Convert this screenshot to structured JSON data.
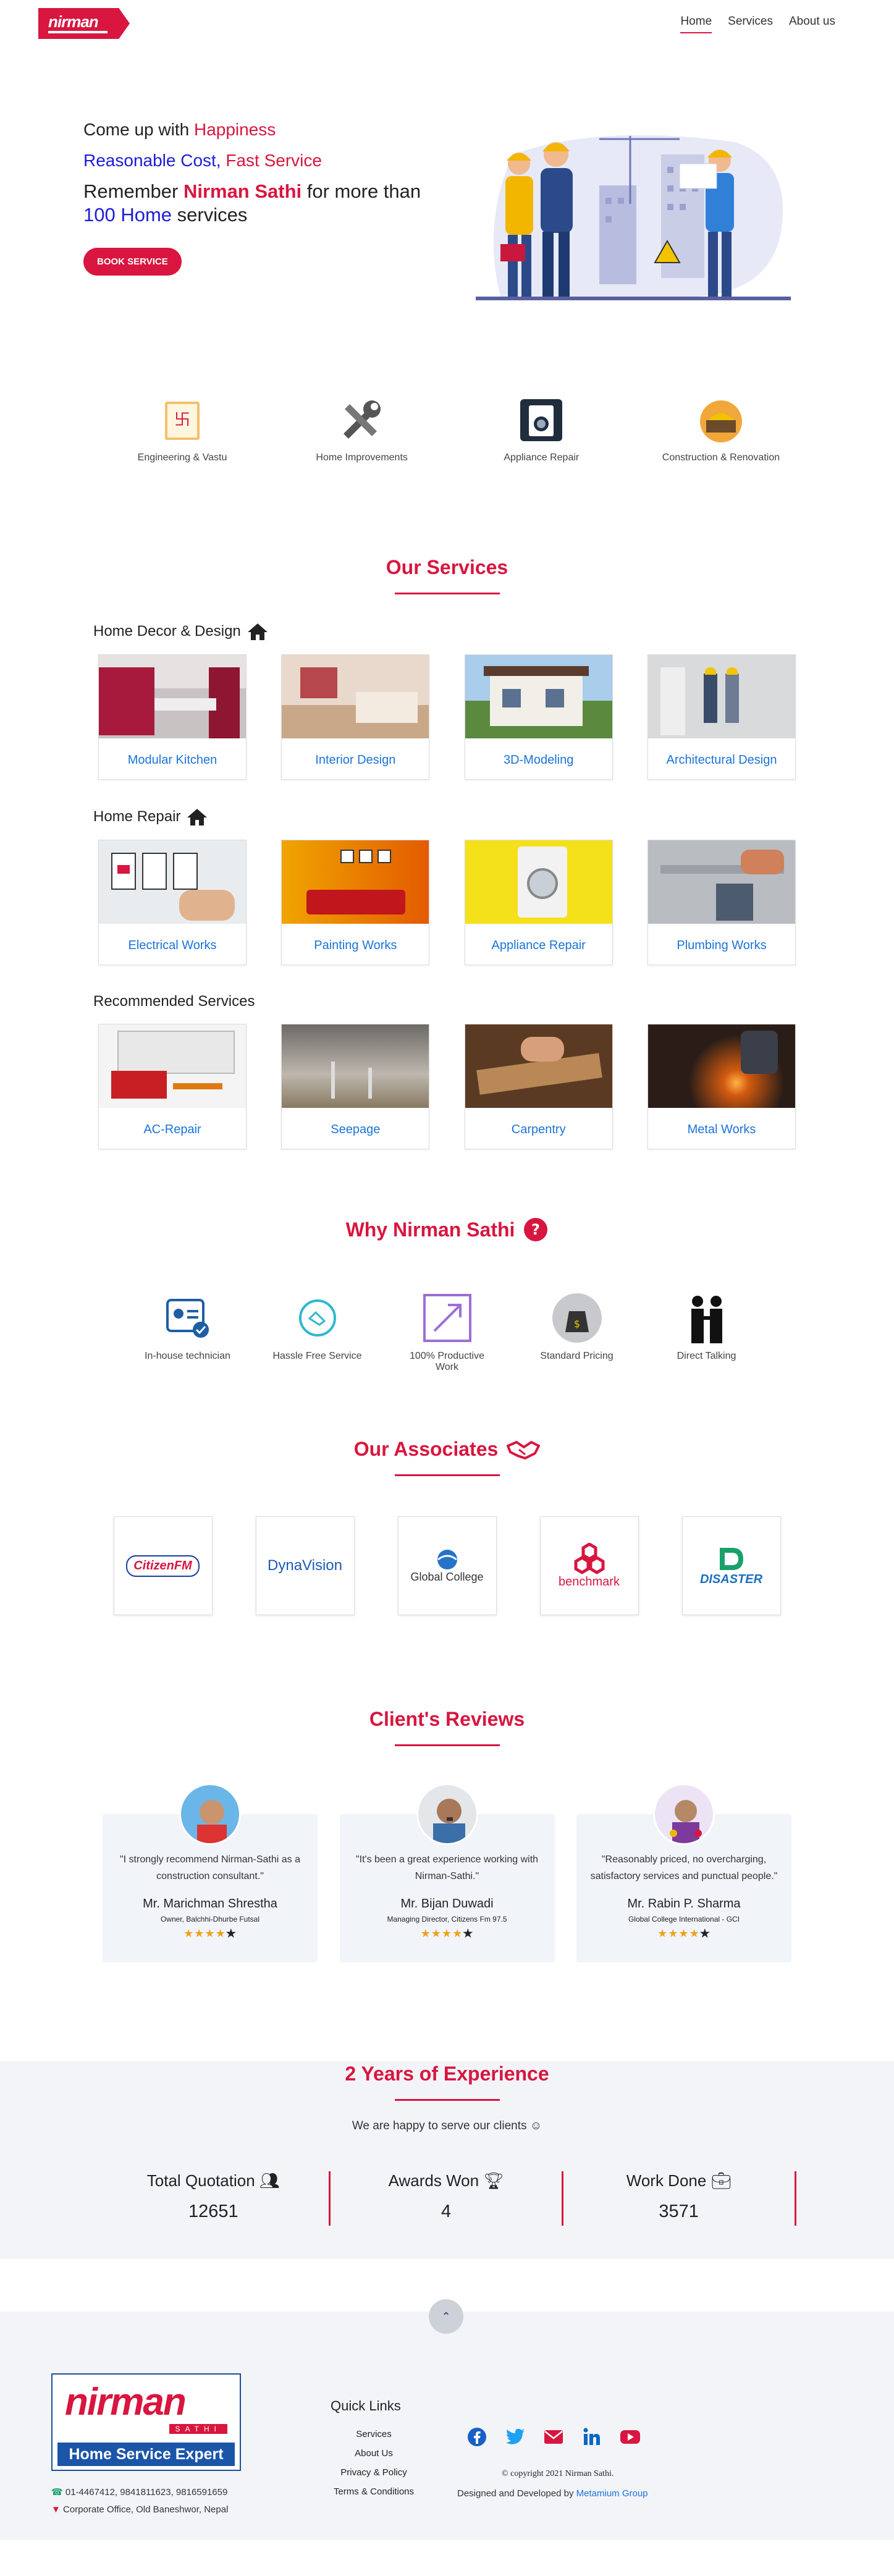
{
  "nav": {
    "logo": "nirman",
    "links": [
      "Home",
      "Services",
      "About us"
    ]
  },
  "hero": {
    "line1_a": "Come up with ",
    "line1_b": "Happiness",
    "line2_a": "Reasonable Cost, ",
    "line2_b": "Fast Service",
    "line3_a": "Remember ",
    "line3_b": "Nirman Sathi",
    "line3_c": " for more than",
    "line4_a": "100 Home",
    "line4_b": " services",
    "button": "BOOK SERVICE"
  },
  "categories": [
    "Engineering & Vastu",
    "Home Improvements",
    "Appliance Repair",
    "Construction & Renovation"
  ],
  "services": {
    "title": "Our Services",
    "groups": [
      {
        "title": "Home Decor & Design",
        "items": [
          "Modular Kitchen",
          "Interior Design",
          "3D-Modeling",
          "Architectural Design"
        ]
      },
      {
        "title": "Home Repair",
        "items": [
          "Electrical Works",
          "Painting Works",
          "Appliance Repair",
          "Plumbing Works"
        ]
      },
      {
        "title": "Recommended Services",
        "items": [
          "AC-Repair",
          "Seepage",
          "Carpentry",
          "Metal Works"
        ]
      }
    ]
  },
  "why": {
    "title": "Why Nirman Sathi",
    "items": [
      "In-house technician",
      "Hassle Free Service",
      "100% Productive Work",
      "Standard Pricing",
      "Direct Talking"
    ]
  },
  "associates": {
    "title": "Our Associates",
    "logos": [
      "CitizenFM",
      "DynaVision",
      "Global College",
      "benchmark",
      "DISASTER"
    ]
  },
  "reviews": {
    "title": "Client's Reviews",
    "items": [
      {
        "quote": "\"I strongly recommend Nirman-Sathi as a construction consultant.\"",
        "name": "Mr. Marichman Shrestha",
        "role": "Owner, Balchhi-Dhurbe Futsal",
        "stars": "★★★★",
        "last": "★"
      },
      {
        "quote": "\"It's been a great experience working with Nirman-Sathi.\"",
        "name": "Mr. Bijan Duwadi",
        "role": "Managing Director, Citizens Fm 97.5",
        "stars": "★★★★",
        "last": "★"
      },
      {
        "quote": "\"Reasonably priced, no overcharging, satisfactory services and punctual people.\"",
        "name": "Mr. Rabin P. Sharma",
        "role": "Global College International - GCI",
        "stars": "★★★★",
        "last": "★"
      }
    ]
  },
  "experience": {
    "title": "2 Years of Experience",
    "subtitle": "We are happy to serve our clients ☺",
    "stats": [
      {
        "label": "Total Quotation",
        "value": "12651",
        "icon": "users-icon"
      },
      {
        "label": "Awards Won",
        "value": "4",
        "icon": "trophy-icon"
      },
      {
        "label": "Work Done",
        "value": "3571",
        "icon": "briefcase-icon"
      }
    ]
  },
  "footer": {
    "logo_word": "nirman",
    "logo_sathi": "SATHI",
    "tagline": "Home Service Expert",
    "phone": "01-4467412, 9841811623, 9816591659",
    "address": "Corporate Office, Old Baneshwor, Nepal",
    "quick_links_title": "Quick Links",
    "quick_links": [
      "Services",
      "About Us",
      "Privacy & Policy",
      "Terms & Conditions"
    ],
    "copyright": "© copyright 2021 Nirman Sathi.",
    "designed_prefix": "Designed and Developed by ",
    "designed_link": "Metamium Group"
  }
}
